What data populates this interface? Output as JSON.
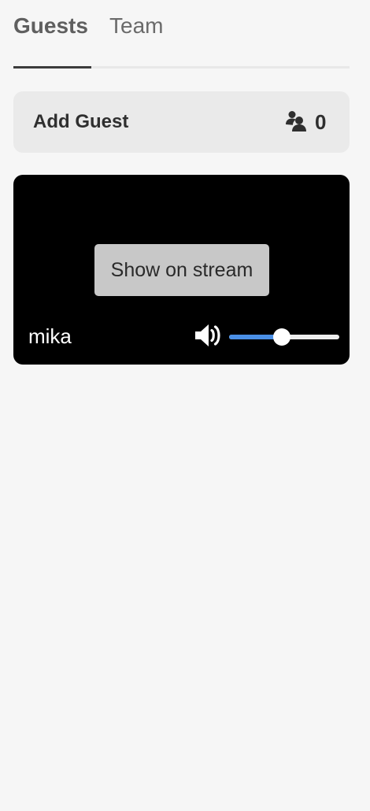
{
  "tabs": [
    {
      "label": "Guests",
      "active": true
    },
    {
      "label": "Team",
      "active": false
    }
  ],
  "add_guest": {
    "label": "Add Guest",
    "icon": "people-icon",
    "count": "0"
  },
  "guest": {
    "name": "mika",
    "show_button_label": "Show on stream",
    "volume_icon": "volume-icon",
    "volume_level": 0.48
  },
  "colors": {
    "slider_fill": "#4a8fe6",
    "card_background": "#000000",
    "page_background": "#f6f6f6"
  }
}
